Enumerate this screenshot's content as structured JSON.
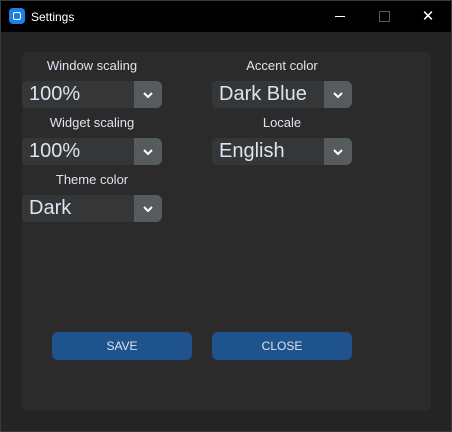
{
  "window": {
    "title": "Settings",
    "icon": "app-logo-icon"
  },
  "colors": {
    "titlebar": "#000000",
    "background": "#242424",
    "panel": "#2b2b2b",
    "dropdown_field": "#343638",
    "dropdown_button": "#565b5e",
    "button": "#1f538d",
    "text": "#dce4ee"
  },
  "settings": {
    "window_scaling": {
      "label": "Window scaling",
      "value": "100%"
    },
    "widget_scaling": {
      "label": "Widget scaling",
      "value": "100%"
    },
    "theme_color": {
      "label": "Theme color",
      "value": "Dark"
    },
    "accent_color": {
      "label": "Accent color",
      "value": "Dark Blue"
    },
    "locale": {
      "label": "Locale",
      "value": "English"
    }
  },
  "buttons": {
    "save": "SAVE",
    "close": "CLOSE"
  }
}
